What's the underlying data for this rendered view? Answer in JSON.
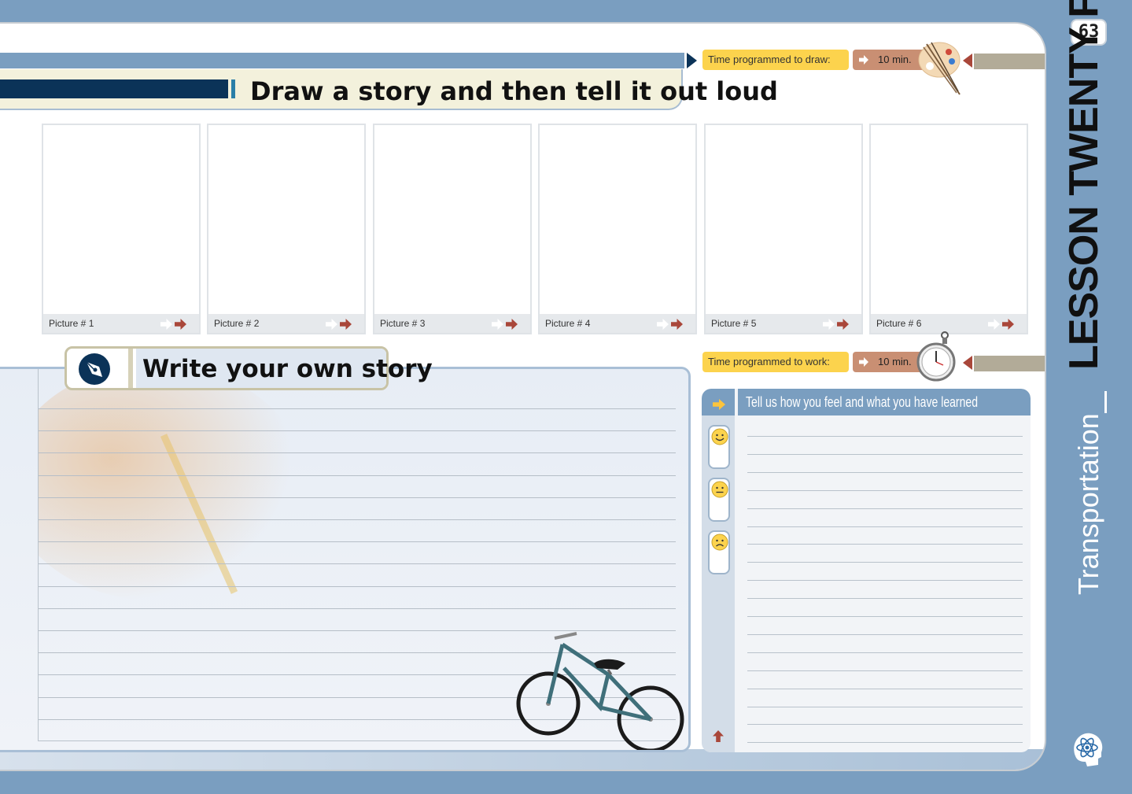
{
  "page_number": "63",
  "lesson_title": "LESSON TWENTY FIVE",
  "lesson_topic": "Transportation",
  "section1": {
    "title": "Draw a story and then tell it out loud",
    "timer_label": "Time programmed to draw:",
    "timer_value": "10 min.",
    "panels": [
      {
        "caption": "Picture # 1"
      },
      {
        "caption": "Picture # 2"
      },
      {
        "caption": "Picture # 3"
      },
      {
        "caption": "Picture # 4"
      },
      {
        "caption": "Picture # 5"
      },
      {
        "caption": "Picture # 6"
      }
    ]
  },
  "section2": {
    "title": "Write your own story",
    "timer_label": "Time programmed to work:",
    "timer_value": "10 min."
  },
  "feedback": {
    "title": "Tell us how you feel and what you have learned",
    "moods": [
      "happy-face-icon",
      "neutral-face-icon",
      "sad-face-icon"
    ]
  },
  "colors": {
    "background_blue": "#7a9ec0",
    "navy": "#0b3358",
    "timer_yellow": "#fcd34d",
    "timer_brown": "#c98f73",
    "accent_red": "#a9473a"
  }
}
